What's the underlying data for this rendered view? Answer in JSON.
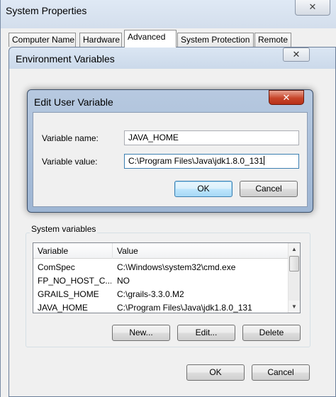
{
  "system_properties": {
    "title": "System Properties",
    "close_glyph": "✕",
    "tabs": [
      {
        "label": "Computer Name",
        "active": false
      },
      {
        "label": "Hardware",
        "active": false
      },
      {
        "label": "Advanced",
        "active": true
      },
      {
        "label": "System Protection",
        "active": false
      },
      {
        "label": "Remote",
        "active": false
      }
    ]
  },
  "environment_variables": {
    "title": "Environment Variables",
    "close_glyph": "✕",
    "system_variables": {
      "group_label": "System variables",
      "columns": [
        "Variable",
        "Value"
      ],
      "rows": [
        {
          "variable": "ComSpec",
          "value": "C:\\Windows\\system32\\cmd.exe"
        },
        {
          "variable": "FP_NO_HOST_C...",
          "value": "NO"
        },
        {
          "variable": "GRAILS_HOME",
          "value": "C:\\grails-3.3.0.M2"
        },
        {
          "variable": "JAVA_HOME",
          "value": "C:\\Program Files\\Java\\jdk1.8.0_131"
        }
      ],
      "buttons": {
        "new": "New...",
        "edit": "Edit...",
        "delete": "Delete"
      }
    },
    "ok_label": "OK",
    "cancel_label": "Cancel"
  },
  "edit_user_variable": {
    "title": "Edit User Variable",
    "close_glyph": "✕",
    "name_label": "Variable name:",
    "name_value": "JAVA_HOME",
    "value_label": "Variable value:",
    "value_value": "C:\\Program Files\\Java\\jdk1.8.0_131",
    "ok_label": "OK",
    "cancel_label": "Cancel"
  }
}
